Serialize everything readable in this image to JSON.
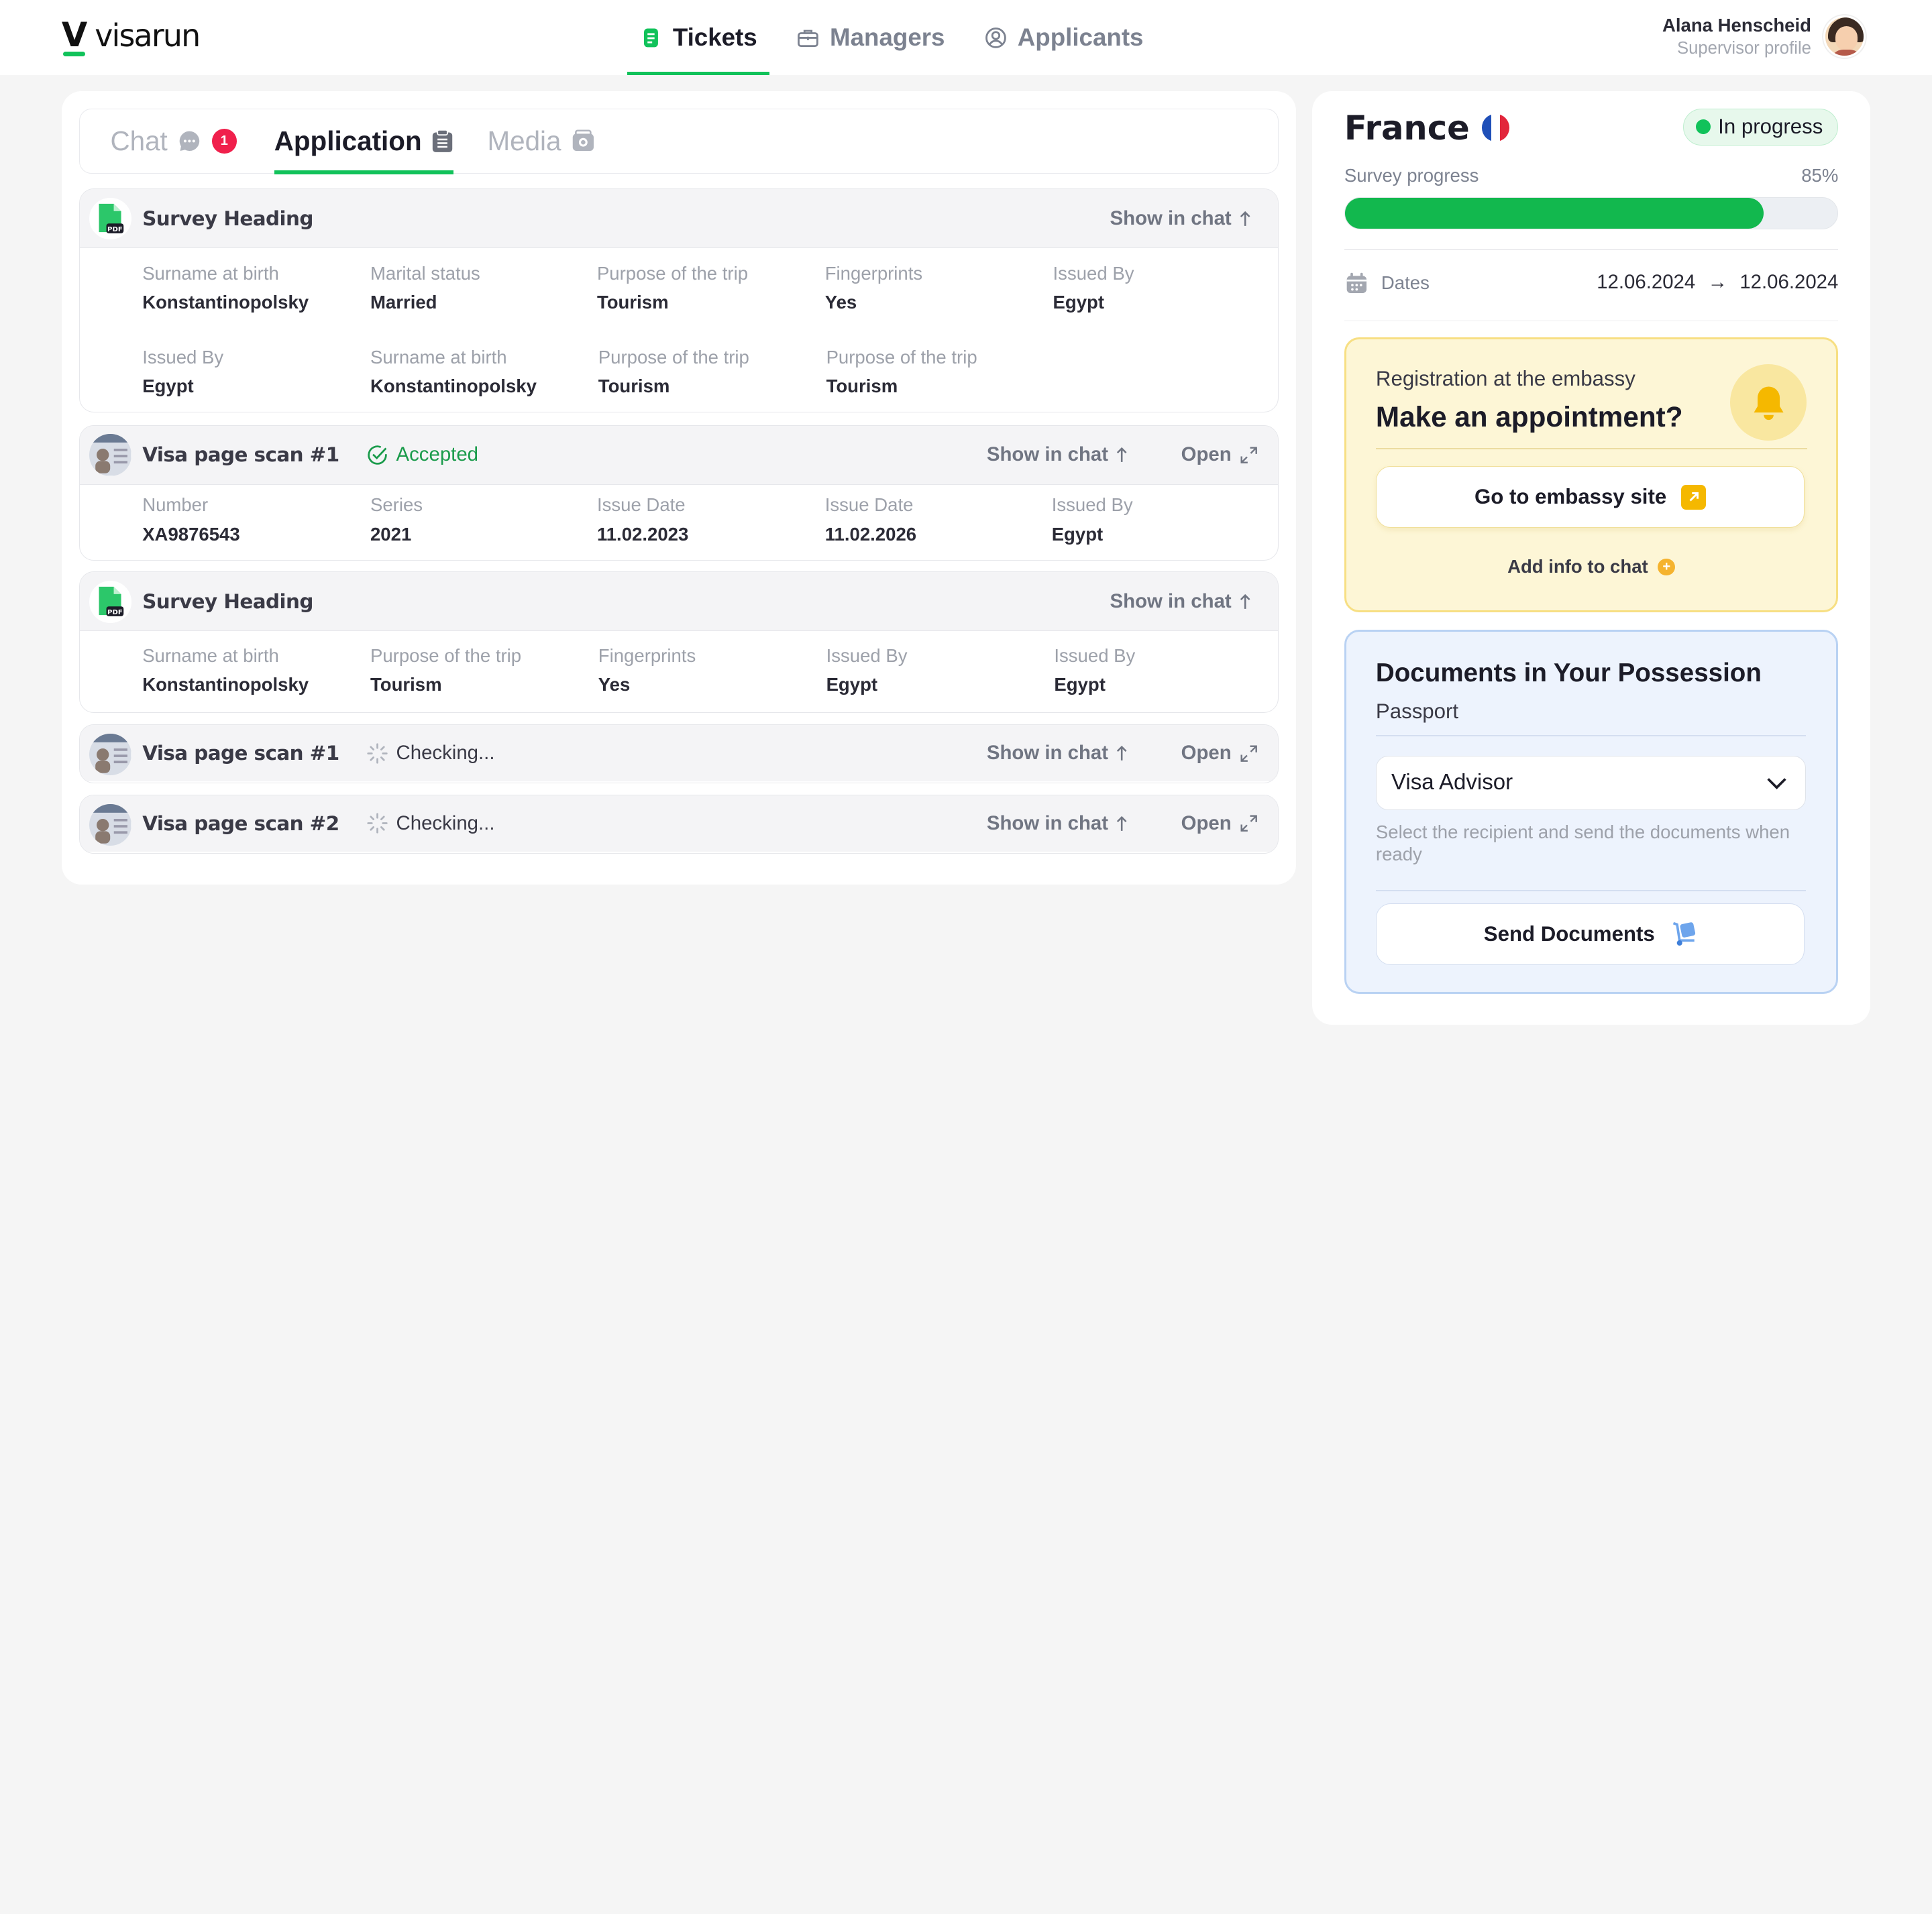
{
  "app": {
    "brand": "visarun",
    "logo_letter": "V"
  },
  "nav": [
    {
      "label": "Tickets",
      "icon": "ticket-icon",
      "active": true
    },
    {
      "label": "Managers",
      "icon": "briefcase-icon",
      "active": false
    },
    {
      "label": "Applicants",
      "icon": "user-circle-icon",
      "active": false
    }
  ],
  "user": {
    "name": "Alana Henscheid",
    "role": "Supervisor profile"
  },
  "tabs": [
    {
      "label": "Chat",
      "badge": "1",
      "icon": "chat-bubble-icon"
    },
    {
      "label": "Application",
      "icon": "clipboard-icon",
      "active": true
    },
    {
      "label": "Media",
      "icon": "wallet-icon"
    }
  ],
  "actions": {
    "show_in_chat": "Show in chat",
    "open": "Open"
  },
  "cards": [
    {
      "title": "Survey Heading",
      "rows": [
        [
          {
            "label": "Surname at birth",
            "value": "Konstantinopolsky"
          },
          {
            "label": "Marital status",
            "value": "Married"
          },
          {
            "label": "Purpose of the trip",
            "value": "Tourism"
          },
          {
            "label": "Fingerprints",
            "value": "Yes"
          },
          {
            "label": "Issued By",
            "value": "Egypt"
          }
        ],
        [
          {
            "label": "Issued By",
            "value": "Egypt"
          },
          {
            "label": "Surname at birth",
            "value": "Konstantinopolsky"
          },
          {
            "label": "Purpose of the trip",
            "value": "Tourism"
          },
          {
            "label": "Purpose of the trip",
            "value": "Tourism"
          }
        ]
      ]
    },
    {
      "title": "Visa page scan #1",
      "status": "Accepted",
      "rows": [
        [
          {
            "label": "Number",
            "value": "XA9876543"
          },
          {
            "label": "Series",
            "value": "2021"
          },
          {
            "label": "Issue Date",
            "value": "11.02.2023"
          },
          {
            "label": "Issue Date",
            "value": "11.02.2026"
          },
          {
            "label": "Issued By",
            "value": "Egypt"
          }
        ]
      ]
    },
    {
      "title": "Survey Heading",
      "rows": [
        [
          {
            "label": "Surname at birth",
            "value": "Konstantinopolsky"
          },
          {
            "label": "Purpose of the trip",
            "value": "Tourism"
          },
          {
            "label": "Fingerprints",
            "value": "Yes"
          },
          {
            "label": "Issued By",
            "value": "Egypt"
          },
          {
            "label": "Issued By",
            "value": "Egypt"
          }
        ]
      ]
    },
    {
      "title": "Visa page scan #1",
      "status": "Checking..."
    },
    {
      "title": "Visa page scan #2",
      "status": "Checking..."
    }
  ],
  "side": {
    "country": "France",
    "status": "In progress",
    "status_color": "#11c25a",
    "survey_label": "Survey progress",
    "survey_value": "85%",
    "survey_fraction": 0.85,
    "dates_label": "Dates",
    "date_from": "12.06.2024",
    "date_arrow": "→",
    "date_to": "12.06.2024",
    "embassy": {
      "small": "Registration at the embassy",
      "title": "Make an appointment?",
      "button": "Go to embassy site",
      "add_info": "Add info to chat",
      "plus": "+"
    },
    "documents": {
      "title": "Documents in Your Possession",
      "subtitle": "Passport",
      "select_value": "Visa Advisor",
      "hint": "Select the recipient and send the documents when ready",
      "button": "Send Documents"
    }
  },
  "colors": {
    "accent": "#11c25a",
    "badge": "#f0204c",
    "embassy_bg": "#fdf6d6",
    "docs_bg": "#edf3fd"
  }
}
